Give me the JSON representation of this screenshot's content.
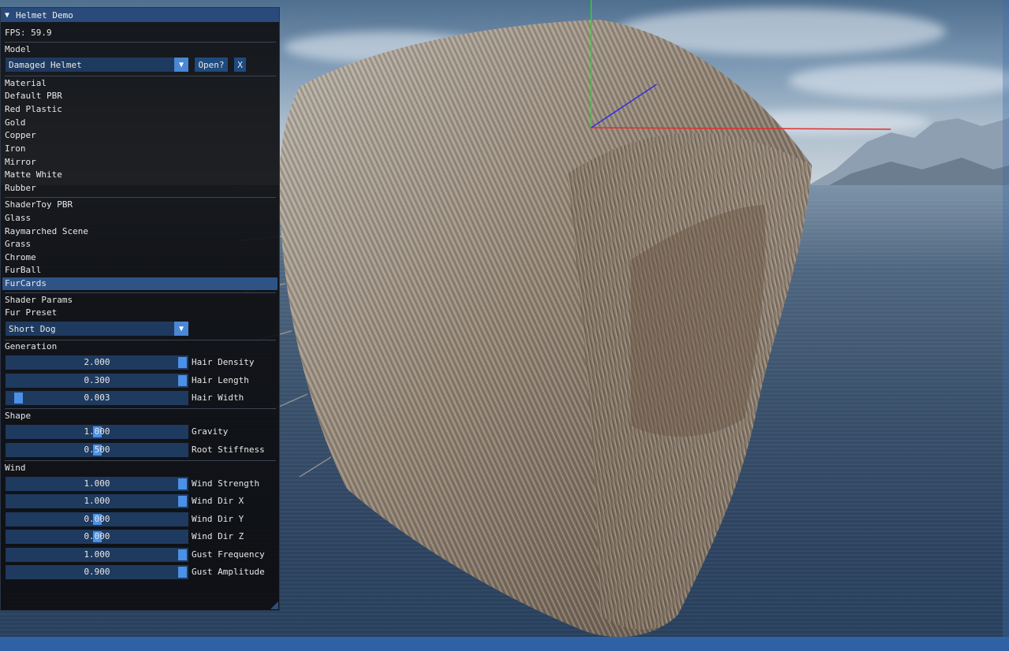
{
  "window": {
    "title": "Helmet Demo"
  },
  "fps": "FPS: 59.9",
  "model": {
    "header": "Model",
    "selected": "Damaged Helmet",
    "open_label": "Open?",
    "close_label": "X"
  },
  "materials": {
    "header": "Material",
    "items": [
      "Default PBR",
      "Red Plastic",
      "Gold",
      "Copper",
      "Iron",
      "Mirror",
      "Matte White",
      "Rubber"
    ]
  },
  "shaders": {
    "items": [
      "ShaderToy PBR",
      "Glass",
      "Raymarched Scene",
      "Grass",
      "Chrome",
      "FurBall",
      "FurCards"
    ],
    "selected": "FurCards"
  },
  "shader_params": {
    "header": "Shader Params",
    "preset_label": "Fur Preset",
    "preset_value": "Short Dog"
  },
  "generation": {
    "header": "Generation",
    "sliders": [
      {
        "label": "Hair Density",
        "value": "2.000",
        "fraction": 1.0
      },
      {
        "label": "Hair Length",
        "value": "0.300",
        "fraction": 1.0
      },
      {
        "label": "Hair Width",
        "value": "0.003",
        "fraction": 0.04
      }
    ]
  },
  "shape": {
    "header": "Shape",
    "sliders": [
      {
        "label": "Gravity",
        "value": "1.000",
        "fraction": 0.5
      },
      {
        "label": "Root Stiffness",
        "value": "0.500",
        "fraction": 0.5
      }
    ]
  },
  "wind": {
    "header": "Wind",
    "sliders": [
      {
        "label": "Wind Strength",
        "value": "1.000",
        "fraction": 1.0
      },
      {
        "label": "Wind Dir X",
        "value": "1.000",
        "fraction": 1.0
      },
      {
        "label": "Wind Dir Y",
        "value": "0.000",
        "fraction": 0.5
      },
      {
        "label": "Wind Dir Z",
        "value": "0.000",
        "fraction": 0.5
      },
      {
        "label": "Gust Frequency",
        "value": "1.000",
        "fraction": 1.0
      },
      {
        "label": "Gust Amplitude",
        "value": "0.900",
        "fraction": 1.0
      }
    ]
  },
  "colors": {
    "accent": "#4a90e6",
    "frame_bg": "#1f3a5f",
    "title_bg": "#294a7a",
    "selected_bg": "#2e5487",
    "axis_x": "#e03030",
    "axis_y": "#30d030",
    "axis_z": "#3030e0"
  }
}
